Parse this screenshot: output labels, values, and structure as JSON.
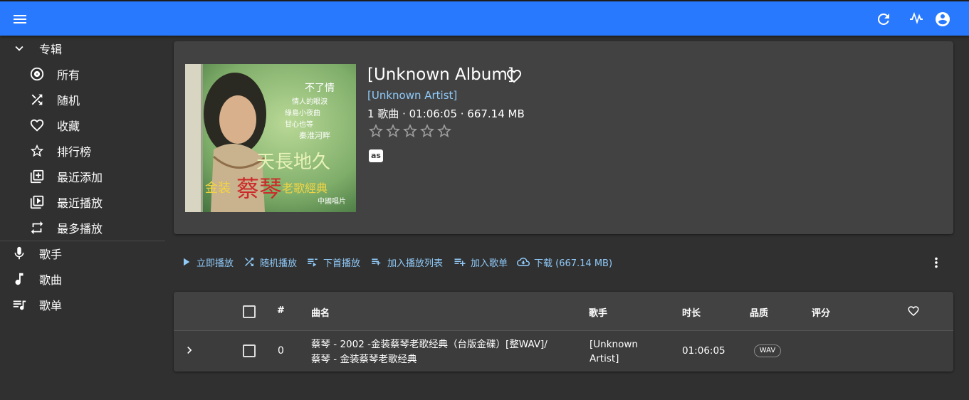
{
  "sidebar": {
    "albums_label": "专辑",
    "items": [
      {
        "label": "所有",
        "icon": "album-icon"
      },
      {
        "label": "随机",
        "icon": "shuffle-icon"
      },
      {
        "label": "收藏",
        "icon": "heart-icon"
      },
      {
        "label": "排行榜",
        "icon": "star-icon"
      },
      {
        "label": "最近添加",
        "icon": "library-add-icon"
      },
      {
        "label": "最近播放",
        "icon": "video-library-icon"
      },
      {
        "label": "最多播放",
        "icon": "repeat-icon"
      }
    ],
    "artists_label": "歌手",
    "songs_label": "歌曲",
    "playlists_label": "歌单"
  },
  "album": {
    "title": "[Unknown Album]",
    "artist": "[Unknown Artist]",
    "meta": "1 歌曲 · 01:06:05 · 667.14 MB",
    "rating": 0,
    "cover_text": {
      "title_top": "不了情",
      "lines": [
        "情人的眼淚",
        "綠島小夜曲",
        "甘心也等",
        "秦淮河畔"
      ],
      "big": "天長地久",
      "brand": "金装",
      "artist": "蔡琴",
      "series": "老歌經典",
      "sub": "中國唱片"
    }
  },
  "toolbar": {
    "play": "立即播放",
    "shuffle": "随机播放",
    "play_next": "下首播放",
    "add_to_queue": "加入播放列表",
    "add_to_playlist": "加入歌单",
    "download": "下载 (667.14 MB)"
  },
  "table": {
    "headers": {
      "num": "#",
      "title": "曲名",
      "artist": "歌手",
      "duration": "时长",
      "quality": "品质",
      "rating": "评分"
    },
    "rows": [
      {
        "num": "0",
        "title_line1": "蔡琴 - 2002 -金装蔡琴老歌经典（台版金碟）[整WAV]/",
        "title_line2": "蔡琴 - 金装蔡琴老歌经典",
        "artist_line1": "[Unknown",
        "artist_line2": "Artist]",
        "duration": "01:06:05",
        "quality": "WAV"
      }
    ]
  },
  "colors": {
    "appbar": "#2979ff",
    "background": "#303030",
    "card": "#424242",
    "link": "#90caf9"
  }
}
